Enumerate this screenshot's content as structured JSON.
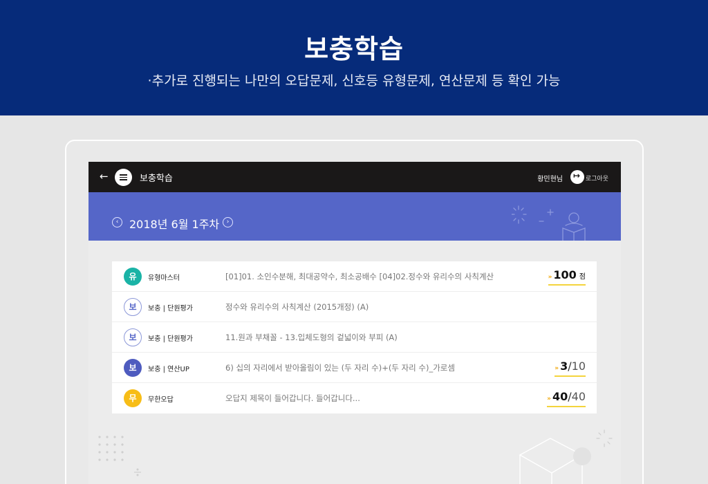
{
  "banner": {
    "title": "보충학습",
    "subtitle": "·추가로 진행되는 나만의 오답문제, 신호등 유형문제, 연산문제 등 확인 가능"
  },
  "app_bar": {
    "back_icon": "←",
    "title": "보충학습",
    "user_name": "황민현님",
    "logout_label": "로그아웃",
    "logout_icon_glyph": "↦"
  },
  "week": {
    "label": "2018년 6월 1주차",
    "prev_glyph": "‹",
    "next_glyph": "›"
  },
  "colors": {
    "banner": "#062b7a",
    "week_bar": "#5566c8",
    "teal": "#1ab3a6",
    "indigo": "#4e5bbf",
    "yellow": "#f7bd17"
  },
  "rows": [
    {
      "badge": "유",
      "category": "유형마스터",
      "desc": "[01]01. 소인수분해, 최대공약수, 최소공배수 [04]02.정수와 유리수의 사칙계산",
      "score": "100",
      "unit": "점",
      "chev": "»"
    },
    {
      "badge": "보",
      "category": "보충 | 단원평가",
      "desc": "정수와 유리수의 사칙계산 (2015개정) (A)"
    },
    {
      "badge": "보",
      "category": "보충 | 단원평가",
      "desc": "11.원과 부채꼴 - 13.입체도형의 겉넓이와 부피 (A)"
    },
    {
      "badge": "보",
      "category": "보충 | 연산UP",
      "desc": "6) 십의 자리에서 받아올림이 있는 (두 자리 수)+(두 자리 수)_가로셈",
      "done": "3",
      "total": "10",
      "slash": "/",
      "chev": "»"
    },
    {
      "badge": "무",
      "category": "무한오답",
      "desc": "오답지 제목이 들어갑니다. 들어갑니다...",
      "done": "40",
      "total": "40",
      "slash": "/",
      "chev": "»"
    }
  ]
}
